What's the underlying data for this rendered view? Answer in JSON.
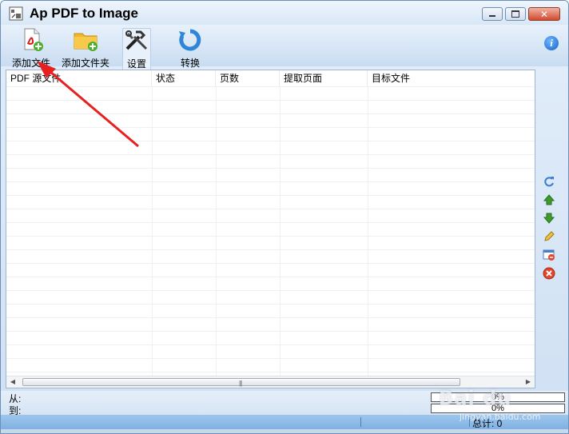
{
  "window": {
    "title": "Ap PDF to Image"
  },
  "toolbar": {
    "add_file": "添加文件",
    "add_folder": "添加文件夹",
    "settings": "设置",
    "convert": "转换",
    "info_icon": "info-icon"
  },
  "table": {
    "columns": [
      "PDF 源文件",
      "状态",
      "页数",
      "提取页面",
      "目标文件"
    ],
    "rows": []
  },
  "sidebar_icons": [
    "refresh-icon",
    "move-up-icon",
    "move-down-icon",
    "edit-icon",
    "remove-icon",
    "delete-icon"
  ],
  "progress": {
    "from_label": "从:",
    "to_label": "到:",
    "from_percent": "0%",
    "to_percent": "0%"
  },
  "status": {
    "total": "总计: 0"
  },
  "watermark": {
    "brand": "Bai du",
    "url": "jingyan.baidu.com"
  },
  "colors": {
    "accent": "#1561c9",
    "arrow": "#e8201f"
  }
}
